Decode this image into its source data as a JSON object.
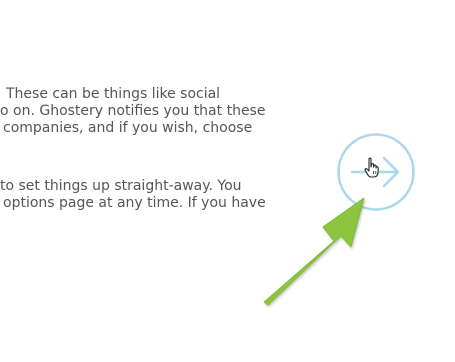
{
  "intro": {
    "lines": [
      "These can be things like social",
      "o on. Ghostery notifies you that these",
      "companies, and if you wish, choose",
      "to set things up straight-away. You",
      "options page at any time. If you have"
    ]
  },
  "next_button": {
    "icon": "arrow-right-icon",
    "color": "#a8d8ee"
  },
  "cursor": {
    "icon": "hand-pointer-icon"
  },
  "callout": {
    "icon": "green-arrow-icon",
    "color": "#8cc63f"
  }
}
